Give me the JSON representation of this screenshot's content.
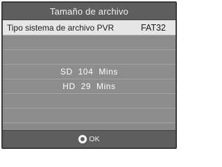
{
  "dialog": {
    "title": "Tamaño de archivo"
  },
  "file_system": {
    "label": "Tipo sistema de archivo PVR",
    "value": "FAT32"
  },
  "capacity": {
    "sd": "SD  104  Mins",
    "hd": "HD  29  Mins"
  },
  "footer": {
    "ok_label": "OK"
  }
}
